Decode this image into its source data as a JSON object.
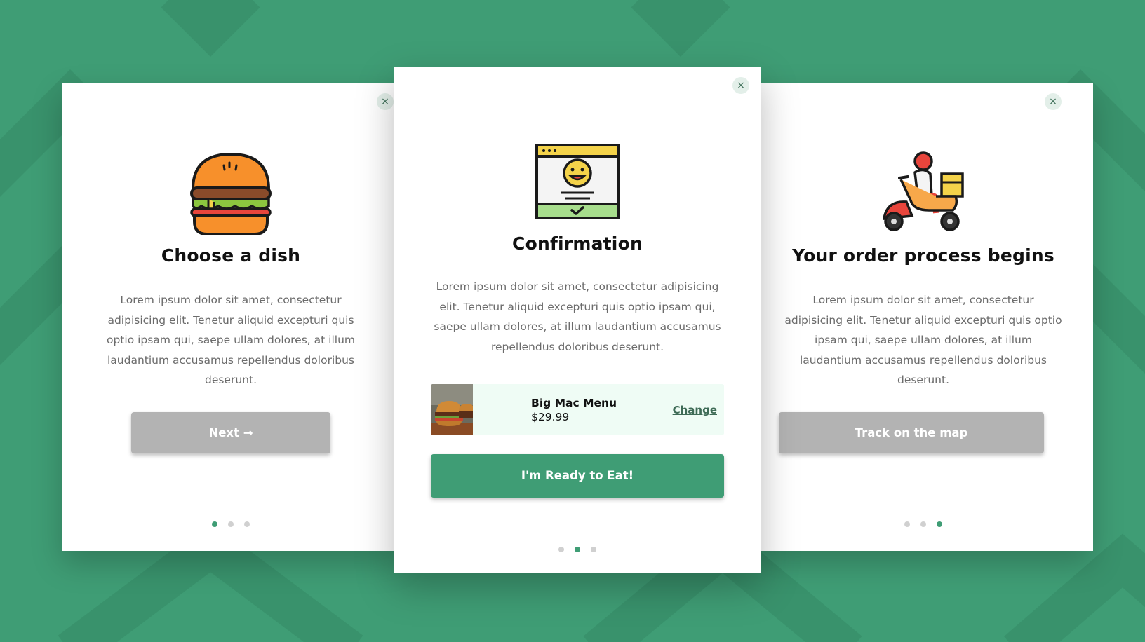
{
  "cards": [
    {
      "icon": "burger-icon",
      "title": "Choose a dish",
      "description": "Lorem ipsum dolor sit amet, consectetur adipisicing elit. Tenetur aliquid excepturi quis optio ipsam qui, saepe ullam dolores, at illum laudantium accusamus repellendus doloribus deserunt.",
      "button_label": "Next →",
      "active_step": 1,
      "step_count": 3
    },
    {
      "icon": "confirmation-window-icon",
      "title": "Confirmation",
      "description": "Lorem ipsum dolor sit amet, consectetur adipisicing elit. Tenetur aliquid excepturi quis optio ipsam qui, saepe ullam dolores, at illum laudantium accusamus repellendus doloribus deserunt.",
      "order": {
        "item_name": "Big Mac Menu",
        "price": "$29.99",
        "change_label": "Change"
      },
      "button_label": "I'm Ready to Eat!",
      "active_step": 2,
      "step_count": 3
    },
    {
      "icon": "delivery-scooter-icon",
      "title": "Your order process begins",
      "description": "Lorem ipsum dolor sit amet, consectetur adipisicing elit. Tenetur aliquid excepturi quis optio ipsam qui, saepe ullam dolores, at illum laudantium accusamus repellendus doloribus deserunt.",
      "button_label": "Track on the map",
      "active_step": 3,
      "step_count": 3
    }
  ],
  "close_glyph": "×",
  "colors": {
    "background": "#3f9d75",
    "accent": "#3f9d75",
    "button_disabled": "#b3b3b3",
    "order_bg": "#effcf5"
  }
}
